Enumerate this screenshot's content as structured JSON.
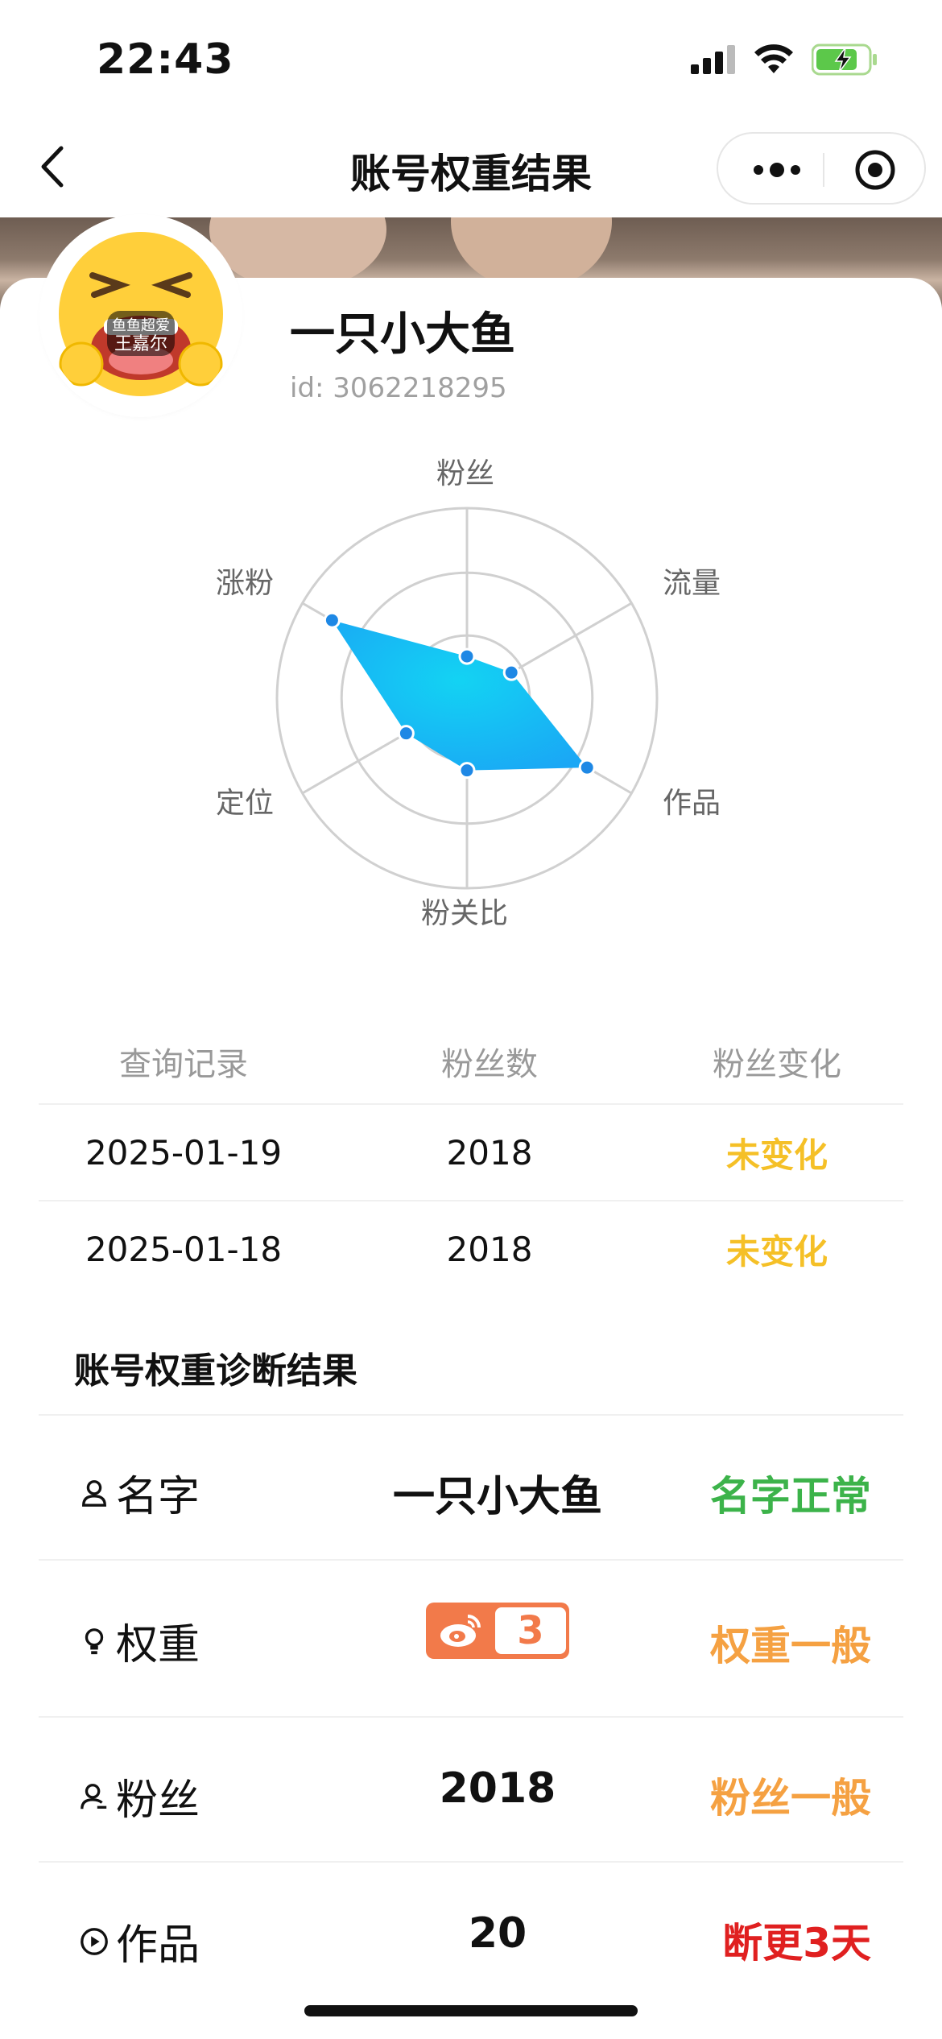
{
  "status_bar": {
    "time": "22:43"
  },
  "nav": {
    "title": "账号权重结果"
  },
  "profile": {
    "name": "一只小大鱼",
    "id_text": "id: 3062218295",
    "avatar_text_top": "鱼鱼超爱",
    "avatar_text_bottom": "王嘉尔"
  },
  "radar": {
    "axes": [
      "粉丝",
      "流量",
      "作品",
      "粉关比",
      "定位",
      "涨粉"
    ],
    "values": [
      0.22,
      0.27,
      0.73,
      0.38,
      0.37,
      0.82
    ],
    "fill_color": "#1aa7f5",
    "point_color": "#1e88e5"
  },
  "history": {
    "headers": [
      "查询记录",
      "粉丝数",
      "粉丝变化"
    ],
    "rows": [
      {
        "date": "2025-01-19",
        "fans": "2018",
        "change": "未变化"
      },
      {
        "date": "2025-01-18",
        "fans": "2018",
        "change": "未变化"
      }
    ]
  },
  "diagnosis": {
    "title": "账号权重诊断结果",
    "rows": [
      {
        "label": "名字",
        "value": "一只小大鱼",
        "result": "名字正常",
        "result_color": "#3cb34a"
      },
      {
        "label": "权重",
        "value": "3",
        "result": "权重一般",
        "result_color": "#f5a142"
      },
      {
        "label": "粉丝",
        "value": "2018",
        "result": "粉丝一般",
        "result_color": "#f5a142"
      },
      {
        "label": "作品",
        "value": "20",
        "result": "断更3天",
        "result_color": "#e02020"
      }
    ]
  }
}
